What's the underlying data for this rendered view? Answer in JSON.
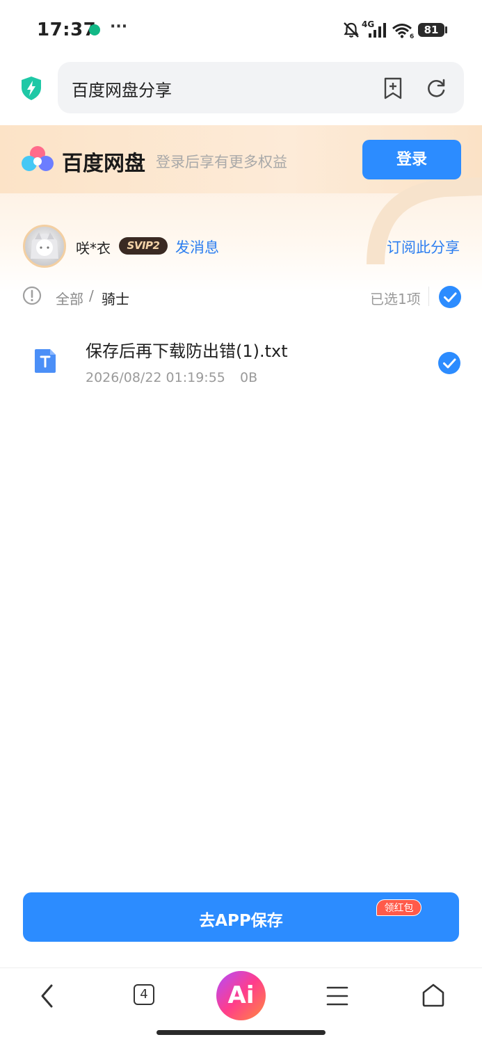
{
  "status_bar": {
    "time": "17:37",
    "more": "···",
    "network": "4G",
    "battery": "81",
    "icons": [
      "app-notification-icon",
      "mute-bell-icon",
      "signal-icon",
      "wifi-icon",
      "battery-icon"
    ]
  },
  "browser": {
    "address_text": "百度网盘分享",
    "icons": [
      "shield-icon",
      "add-bookmark-icon",
      "reload-icon"
    ]
  },
  "header": {
    "brand_name": "百度网盘",
    "slogan": "登录后享有更多权益",
    "login_label": "登录",
    "accent_color": "#2c8cff"
  },
  "sharer": {
    "name": "咲*衣",
    "vip_badge": "SVIP2",
    "send_message": "发消息",
    "subscribe": "订阅此分享"
  },
  "breadcrumb": {
    "root": "全部",
    "separator": "/",
    "current": "骑士",
    "selected_count": "已选1项"
  },
  "files": [
    {
      "name": "保存后再下载防出错(1).txt",
      "date": "2026/08/22 01:19:55",
      "size": "0B",
      "type_icon": "txt-file-icon",
      "checked": true
    }
  ],
  "footer": {
    "save_label": "去APP保存",
    "redpack_label": "领红包"
  },
  "bottom_nav": {
    "tabs_count": "4",
    "ai_label": "Ai",
    "items": [
      "back-icon",
      "tabs-icon",
      "ai-assistant-icon",
      "menu-icon",
      "home-icon"
    ]
  }
}
